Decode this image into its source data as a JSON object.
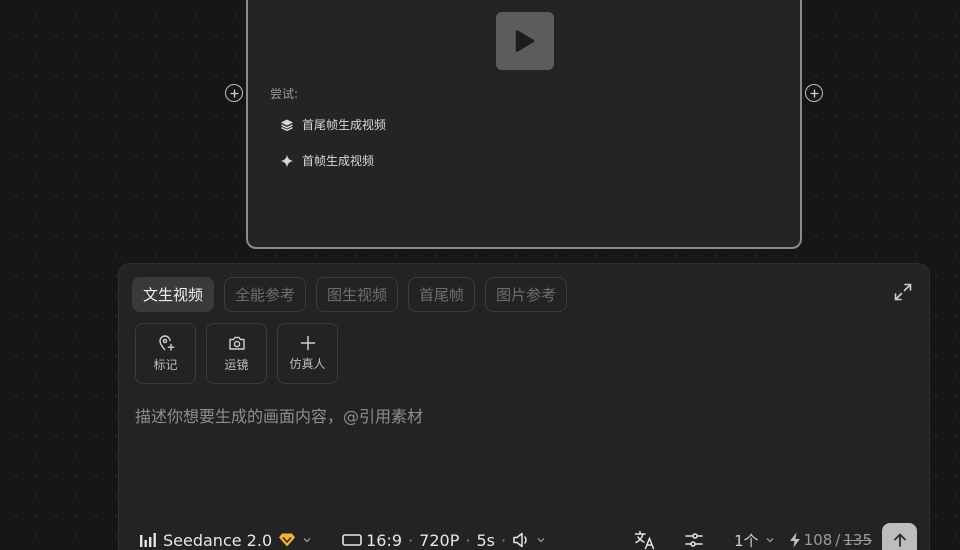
{
  "card": {
    "try_label": "尝试:",
    "suggestions": [
      {
        "label": "首尾帧生成视频",
        "icon": "layers-icon"
      },
      {
        "label": "首帧生成视频",
        "icon": "sparkle-icon"
      }
    ]
  },
  "tabs": [
    {
      "label": "文生视频",
      "active": true
    },
    {
      "label": "全能参考",
      "active": false
    },
    {
      "label": "图生视频",
      "active": false
    },
    {
      "label": "首尾帧",
      "active": false
    },
    {
      "label": "图片参考",
      "active": false
    }
  ],
  "tools": [
    {
      "label": "标记",
      "icon": "map-pin-plus-icon"
    },
    {
      "label": "运镜",
      "icon": "camera-icon"
    },
    {
      "label": "仿真人",
      "icon": "plus-icon"
    }
  ],
  "prompt": {
    "placeholder": "描述你想要生成的画面内容，@引用素材"
  },
  "bottom": {
    "model": "Seedance 2.0",
    "ratio": "16:9",
    "resolution": "720P",
    "duration": "5s",
    "count": "1个",
    "credits": "108",
    "credits_original": "135"
  },
  "colors": {
    "background": "#161616",
    "panel": "#232323",
    "card_border": "#8a8a8a",
    "badge": "#f2b233"
  }
}
